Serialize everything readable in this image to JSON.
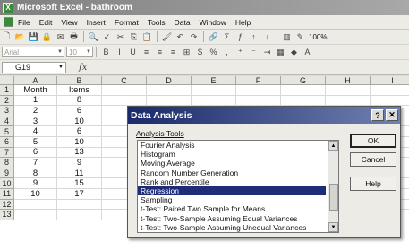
{
  "window": {
    "title": "Microsoft Excel - bathroom"
  },
  "menu": [
    "File",
    "Edit",
    "View",
    "Insert",
    "Format",
    "Tools",
    "Data",
    "Window",
    "Help"
  ],
  "toolbar": {
    "zoom": "100%",
    "font": "Arial",
    "font_size": "10",
    "buttons1": [
      "new-icon",
      "open-icon",
      "save-icon",
      "permission-icon",
      "email-icon",
      "print-icon",
      "print-preview-icon",
      "spelling-icon",
      "cut-icon",
      "copy-icon",
      "paste-icon",
      "format-painter-icon",
      "undo-icon",
      "redo-icon",
      "hyperlink-icon",
      "autosum-icon",
      "function-icon",
      "sort-asc-icon",
      "sort-desc-icon",
      "chart-icon",
      "drawing-icon"
    ],
    "glyphs1": [
      "🗋",
      "📂",
      "💾",
      "🔒",
      "✉",
      "🖶",
      "🔍",
      "✓",
      "✂",
      "⎘",
      "📋",
      "🖌",
      "↶",
      "↷",
      "🔗",
      "Σ",
      "ƒ",
      "↑",
      "↓",
      "▥",
      "✎"
    ],
    "buttons2": [
      "bold-icon",
      "italic-icon",
      "underline-icon",
      "align-left-icon",
      "align-center-icon",
      "align-right-icon",
      "merge-icon",
      "currency-icon",
      "percent-icon",
      "comma-icon",
      "increase-decimal-icon",
      "decrease-decimal-icon",
      "indent-icon",
      "border-icon",
      "fill-color-icon",
      "font-color-icon"
    ],
    "glyphs2": [
      "B",
      "I",
      "U",
      "≡",
      "≡",
      "≡",
      "⊞",
      "$",
      "%",
      ",",
      "⁺",
      "⁻",
      "⇥",
      "▦",
      "◆",
      "A"
    ]
  },
  "formula_bar": {
    "name_box": "G19",
    "fx": "fx"
  },
  "sheet": {
    "columns": [
      "A",
      "B",
      "C",
      "D",
      "E",
      "F",
      "G",
      "H",
      "I"
    ],
    "rows": [
      [
        "Month",
        "Items"
      ],
      [
        "1",
        "8"
      ],
      [
        "2",
        "6"
      ],
      [
        "3",
        "10"
      ],
      [
        "4",
        "6"
      ],
      [
        "5",
        "10"
      ],
      [
        "6",
        "13"
      ],
      [
        "7",
        "9"
      ],
      [
        "8",
        "11"
      ],
      [
        "9",
        "15"
      ],
      [
        "10",
        "17"
      ],
      [
        "",
        ""
      ],
      [
        "",
        ""
      ]
    ]
  },
  "dialog": {
    "title": "Data Analysis",
    "tools_label": "Analysis Tools",
    "items": [
      "Fourier Analysis",
      "Histogram",
      "Moving Average",
      "Random Number Generation",
      "Rank and Percentile",
      "Regression",
      "Sampling",
      "t-Test: Paired Two Sample for Means",
      "t-Test: Two-Sample Assuming Equal Variances",
      "t-Test: Two-Sample Assuming Unequal Variances"
    ],
    "selected_index": 5,
    "ok": "OK",
    "cancel": "Cancel",
    "help": "Help"
  }
}
